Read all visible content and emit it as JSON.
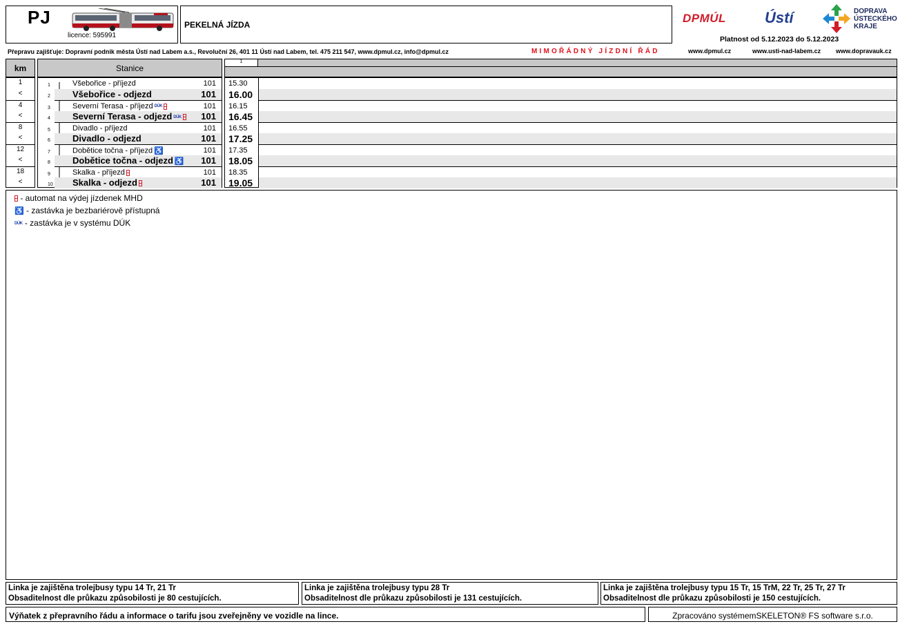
{
  "header": {
    "line_code": "PJ",
    "licence": "licence:  595991",
    "line_name": "PEKELNÁ JÍZDA",
    "operator": "Přepravu zajišťuje: Dopravní podnik města Ústí nad Labem a.s., Revoluční 26, 401 11 Ústí nad Labem, tel. 475 211 547, www.dpmul.cz, info@dpmul.cz",
    "special_notice": "MIMOŘÁDNÝ JÍZDNÍ ŘÁD",
    "validity": "Platnost od 5.12.2023 do 5.12.2023",
    "urls": [
      "www.dpmul.cz",
      "www.usti-nad-labem.cz",
      "www.dopravauk.cz"
    ],
    "logos": {
      "dpmul": "DPMÚL",
      "usti": "Ústí",
      "duk": [
        "DOPRAVA",
        "ÚSTECKÉHO",
        "KRAJE"
      ]
    }
  },
  "table": {
    "km_header": "km",
    "station_header": "Stanice",
    "trip_number": "1",
    "rows": [
      {
        "km": "1",
        "seq": "1",
        "station": "Všebořice - příjezd",
        "zone": "101",
        "time": "15.30",
        "style": "small",
        "icons": []
      },
      {
        "km": "<",
        "seq": "2",
        "station": "Všebořice - odjezd",
        "zone": "101",
        "time": "16.00",
        "style": "big",
        "icons": []
      },
      {
        "km": "4",
        "seq": "3",
        "station": "Severní Terasa - příjezd",
        "zone": "101",
        "time": "16.15",
        "style": "small",
        "icons": [
          "duk",
          "ticket"
        ]
      },
      {
        "km": "<",
        "seq": "4",
        "station": "Severní Terasa - odjezd",
        "zone": "101",
        "time": "16.45",
        "style": "big",
        "icons": [
          "duk",
          "ticket"
        ]
      },
      {
        "km": "8",
        "seq": "5",
        "station": "Divadlo - příjezd",
        "zone": "101",
        "time": "16.55",
        "style": "small",
        "icons": []
      },
      {
        "km": "<",
        "seq": "6",
        "station": "Divadlo - odjezd",
        "zone": "101",
        "time": "17.25",
        "style": "big",
        "icons": []
      },
      {
        "km": "12",
        "seq": "7",
        "station": "Dobětice točna - příjezd",
        "zone": "101",
        "time": "17.35",
        "style": "small",
        "icons": [
          "wheelchair"
        ]
      },
      {
        "km": "<",
        "seq": "8",
        "station": "Dobětice točna - odjezd",
        "zone": "101",
        "time": "18.05",
        "style": "big",
        "icons": [
          "wheelchair"
        ]
      },
      {
        "km": "18",
        "seq": "9",
        "station": "Skalka - příjezd",
        "zone": "101",
        "time": "18.35",
        "style": "small",
        "icons": [
          "ticket"
        ]
      },
      {
        "km": "<",
        "seq": "10",
        "station": "Skalka - odjezd",
        "zone": "101",
        "time": "19.05",
        "style": "big",
        "icons": [
          "ticket"
        ]
      }
    ]
  },
  "legend": [
    {
      "icon": "ticket",
      "text": " - automat na výdej jízdenek MHD"
    },
    {
      "icon": "wheelchair",
      "text": " - zastávka je bezbariérově přístupná"
    },
    {
      "icon": "duk",
      "text": " - zastávka je v systému DÚK"
    }
  ],
  "icon_glyphs": {
    "wheelchair": "♿",
    "duk": "DÚK"
  },
  "footer": {
    "vehicles": [
      {
        "line1": "Linka je zajištěna trolejbusy typu 14 Tr, 21 Tr",
        "line2": "Obsaditelnost dle průkazu způsobilosti je 80 cestujících."
      },
      {
        "line1": "Linka je zajištěna trolejbusy typu 28 Tr",
        "line2": "Obsaditelnost dle průkazu způsobilosti je 131 cestujících."
      },
      {
        "line1": "Linka je zajištěna trolejbusy typu 15 Tr, 15 TrM, 22 Tr, 25 Tr, 27 Tr",
        "line2": "Obsaditelnost dle průkazu způsobilosti je 150 cestujících."
      }
    ],
    "extract_note": "Výňatek z přepravního řádu a informace o tarifu jsou zveřejněny ve vozidle na lince.",
    "processed_by": "Zpracováno systémemSKELETON® FS software s.r.o."
  },
  "colors": {
    "accent_red": "#e0101a",
    "header_gray": "#c8c8c8",
    "shade_gray": "#e8e8e8",
    "icon_blue": "#1f3fb0"
  }
}
